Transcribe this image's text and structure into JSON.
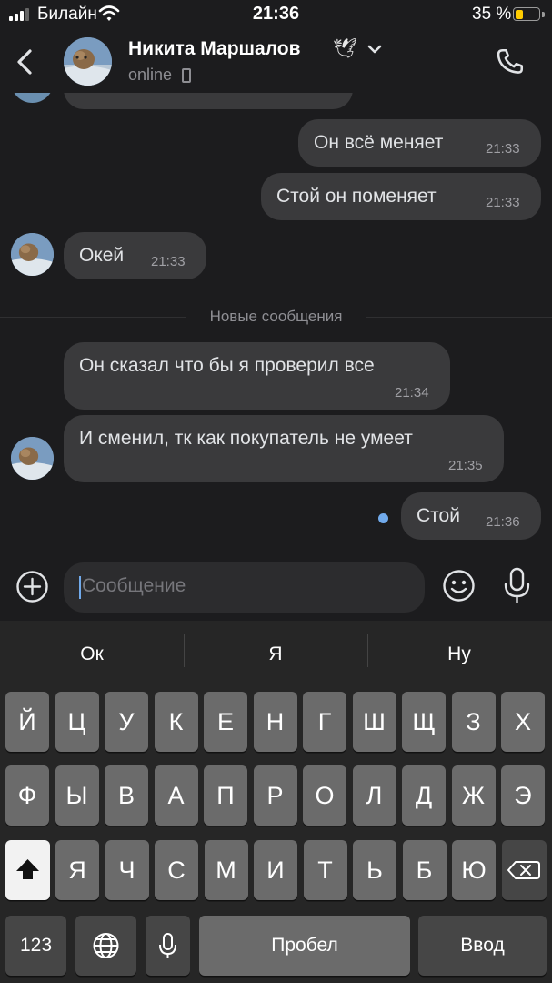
{
  "status_bar": {
    "carrier": "Билайн",
    "time": "21:36",
    "battery_percent": "35 %",
    "battery_level": 0.35,
    "battery_color": "#ffcc00"
  },
  "header": {
    "back_icon": "chevron-left-icon",
    "name": "Никита Маршалов",
    "name_emoji": "🕊",
    "status": "online",
    "status_device_icon": "mobile-phone-icon",
    "call_icon": "phone-icon"
  },
  "messages": [
    {
      "direction": "out",
      "text": "Он всё меняет",
      "time": "21:33"
    },
    {
      "direction": "out",
      "text": "Стой он поменяет",
      "time": "21:33"
    },
    {
      "direction": "in",
      "text": "Окей",
      "time": "21:33"
    },
    {
      "direction": "in",
      "text": "Он сказал что бы я проверил все",
      "time": "21:34"
    },
    {
      "direction": "in",
      "text": "И сменил, тк как покупатель не умеет",
      "time": "21:35"
    },
    {
      "direction": "out",
      "text": "Стой",
      "time": "21:36",
      "unread": true
    }
  ],
  "divider": {
    "label": "Новые сообщения"
  },
  "composer": {
    "placeholder": "Сообщение",
    "attach_icon": "plus-circle-icon",
    "emoji_icon": "smiley-icon",
    "mic_icon": "microphone-icon"
  },
  "keyboard": {
    "suggestions": [
      "Ок",
      "Я",
      "Ну"
    ],
    "row1": [
      "Й",
      "Ц",
      "У",
      "К",
      "Е",
      "Н",
      "Г",
      "Ш",
      "Щ",
      "З",
      "Х"
    ],
    "row2": [
      "Ф",
      "Ы",
      "В",
      "А",
      "П",
      "Р",
      "О",
      "Л",
      "Д",
      "Ж",
      "Э"
    ],
    "row3": [
      "Я",
      "Ч",
      "С",
      "М",
      "И",
      "Т",
      "Ь",
      "Б",
      "Ю"
    ],
    "numbers_key": "123",
    "space_key": "Пробел",
    "return_key": "Ввод",
    "shift_icon": "shift-icon",
    "backspace_icon": "backspace-icon",
    "globe_icon": "globe-icon",
    "dictation_icon": "microphone-icon"
  },
  "colors": {
    "background": "#1c1c1e",
    "bubble": "#3a3a3c",
    "accent": "#71aaeb"
  }
}
